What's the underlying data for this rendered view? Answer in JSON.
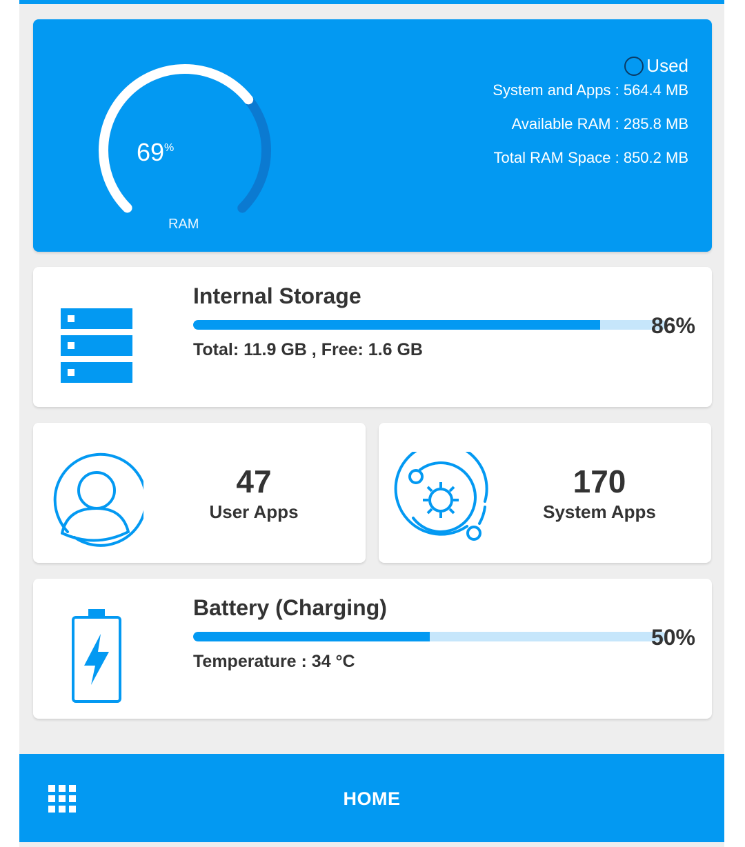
{
  "ram": {
    "percent": "69",
    "percent_unit": "%",
    "percent_value": 69,
    "label": "RAM",
    "legend_label": "Used",
    "system_and_apps": "System and Apps : 564.4 MB",
    "available": "Available RAM : 285.8 MB",
    "total": "Total RAM Space : 850.2 MB"
  },
  "storage": {
    "title": "Internal Storage",
    "percent": "86%",
    "fill_fraction": 0.86,
    "details": "Total:  11.9 GB ,  Free: 1.6 GB",
    "icon": "server-stack-icon"
  },
  "user_apps": {
    "count": "47",
    "label": "User Apps",
    "icon": "user-circle-icon"
  },
  "system_apps": {
    "count": "170",
    "label": "System Apps",
    "icon": "gear-orbit-icon"
  },
  "battery": {
    "title": "Battery (Charging)",
    "percent": "50%",
    "fill_fraction": 0.5,
    "details": "Temperature : 34 °C",
    "icon": "battery-charging-icon"
  },
  "bottom_nav": {
    "menu_icon": "grid-menu-icon",
    "home_label": "HOME"
  },
  "colors": {
    "accent": "#0399f2",
    "track": "#c6e6fb",
    "gauge_remaining": "#0b7ad1",
    "background": "#eeeeee"
  }
}
